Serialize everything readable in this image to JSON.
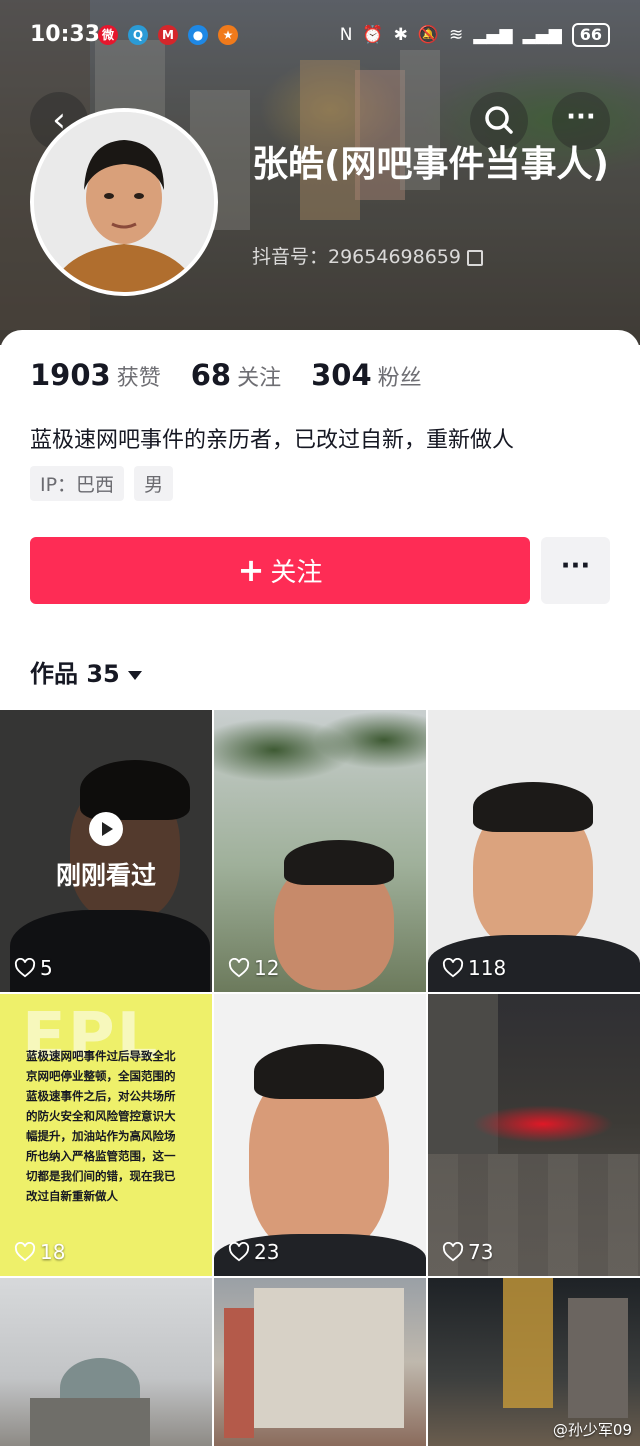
{
  "status_bar": {
    "time": "10:33",
    "battery": "66"
  },
  "profile": {
    "name": "张皓(网吧事件当事人)",
    "douyin_id": "抖音号：29654698659",
    "likes_count": "1903",
    "likes_label": "获赞",
    "following_count": "68",
    "following_label": "关注",
    "followers_count": "304",
    "followers_label": "粉丝",
    "bio": "蓝极速网吧事件的亲历者，已改过自新，重新做人",
    "ip_tag": "IP：巴西",
    "gender_tag": "男"
  },
  "actions": {
    "follow_label": "关注",
    "follow_plus": "+",
    "more_label": "···"
  },
  "works_tab": {
    "label": "作品",
    "count": "35"
  },
  "videos": [
    {
      "likes": "5",
      "overlay": "刚刚看过"
    },
    {
      "likes": "12"
    },
    {
      "likes": "118"
    },
    {
      "likes": "18",
      "title": "EPL",
      "text": "蓝极速网吧事件过后导致全北京网吧停业整顿，全国范围的蓝极速事件之后，对公共场所的防火安全和风险管控意识大幅提升，加油站作为高风险场所也纳入严格监管范围，这一切都是我们间的错，现在我已改过自新重新做人"
    },
    {
      "likes": "23"
    },
    {
      "likes": "73"
    },
    {},
    {},
    {}
  ],
  "watermark": "@孙少军09",
  "icons": [
    "back-icon",
    "search-icon",
    "more-icon",
    "heart-icon",
    "play-icon",
    "copy-icon",
    "dropdown-icon"
  ],
  "colors": {
    "follow_button": "#fe2c55",
    "secondary_button": "#f2f2f4",
    "tag_bg": "#f2f2f4"
  }
}
